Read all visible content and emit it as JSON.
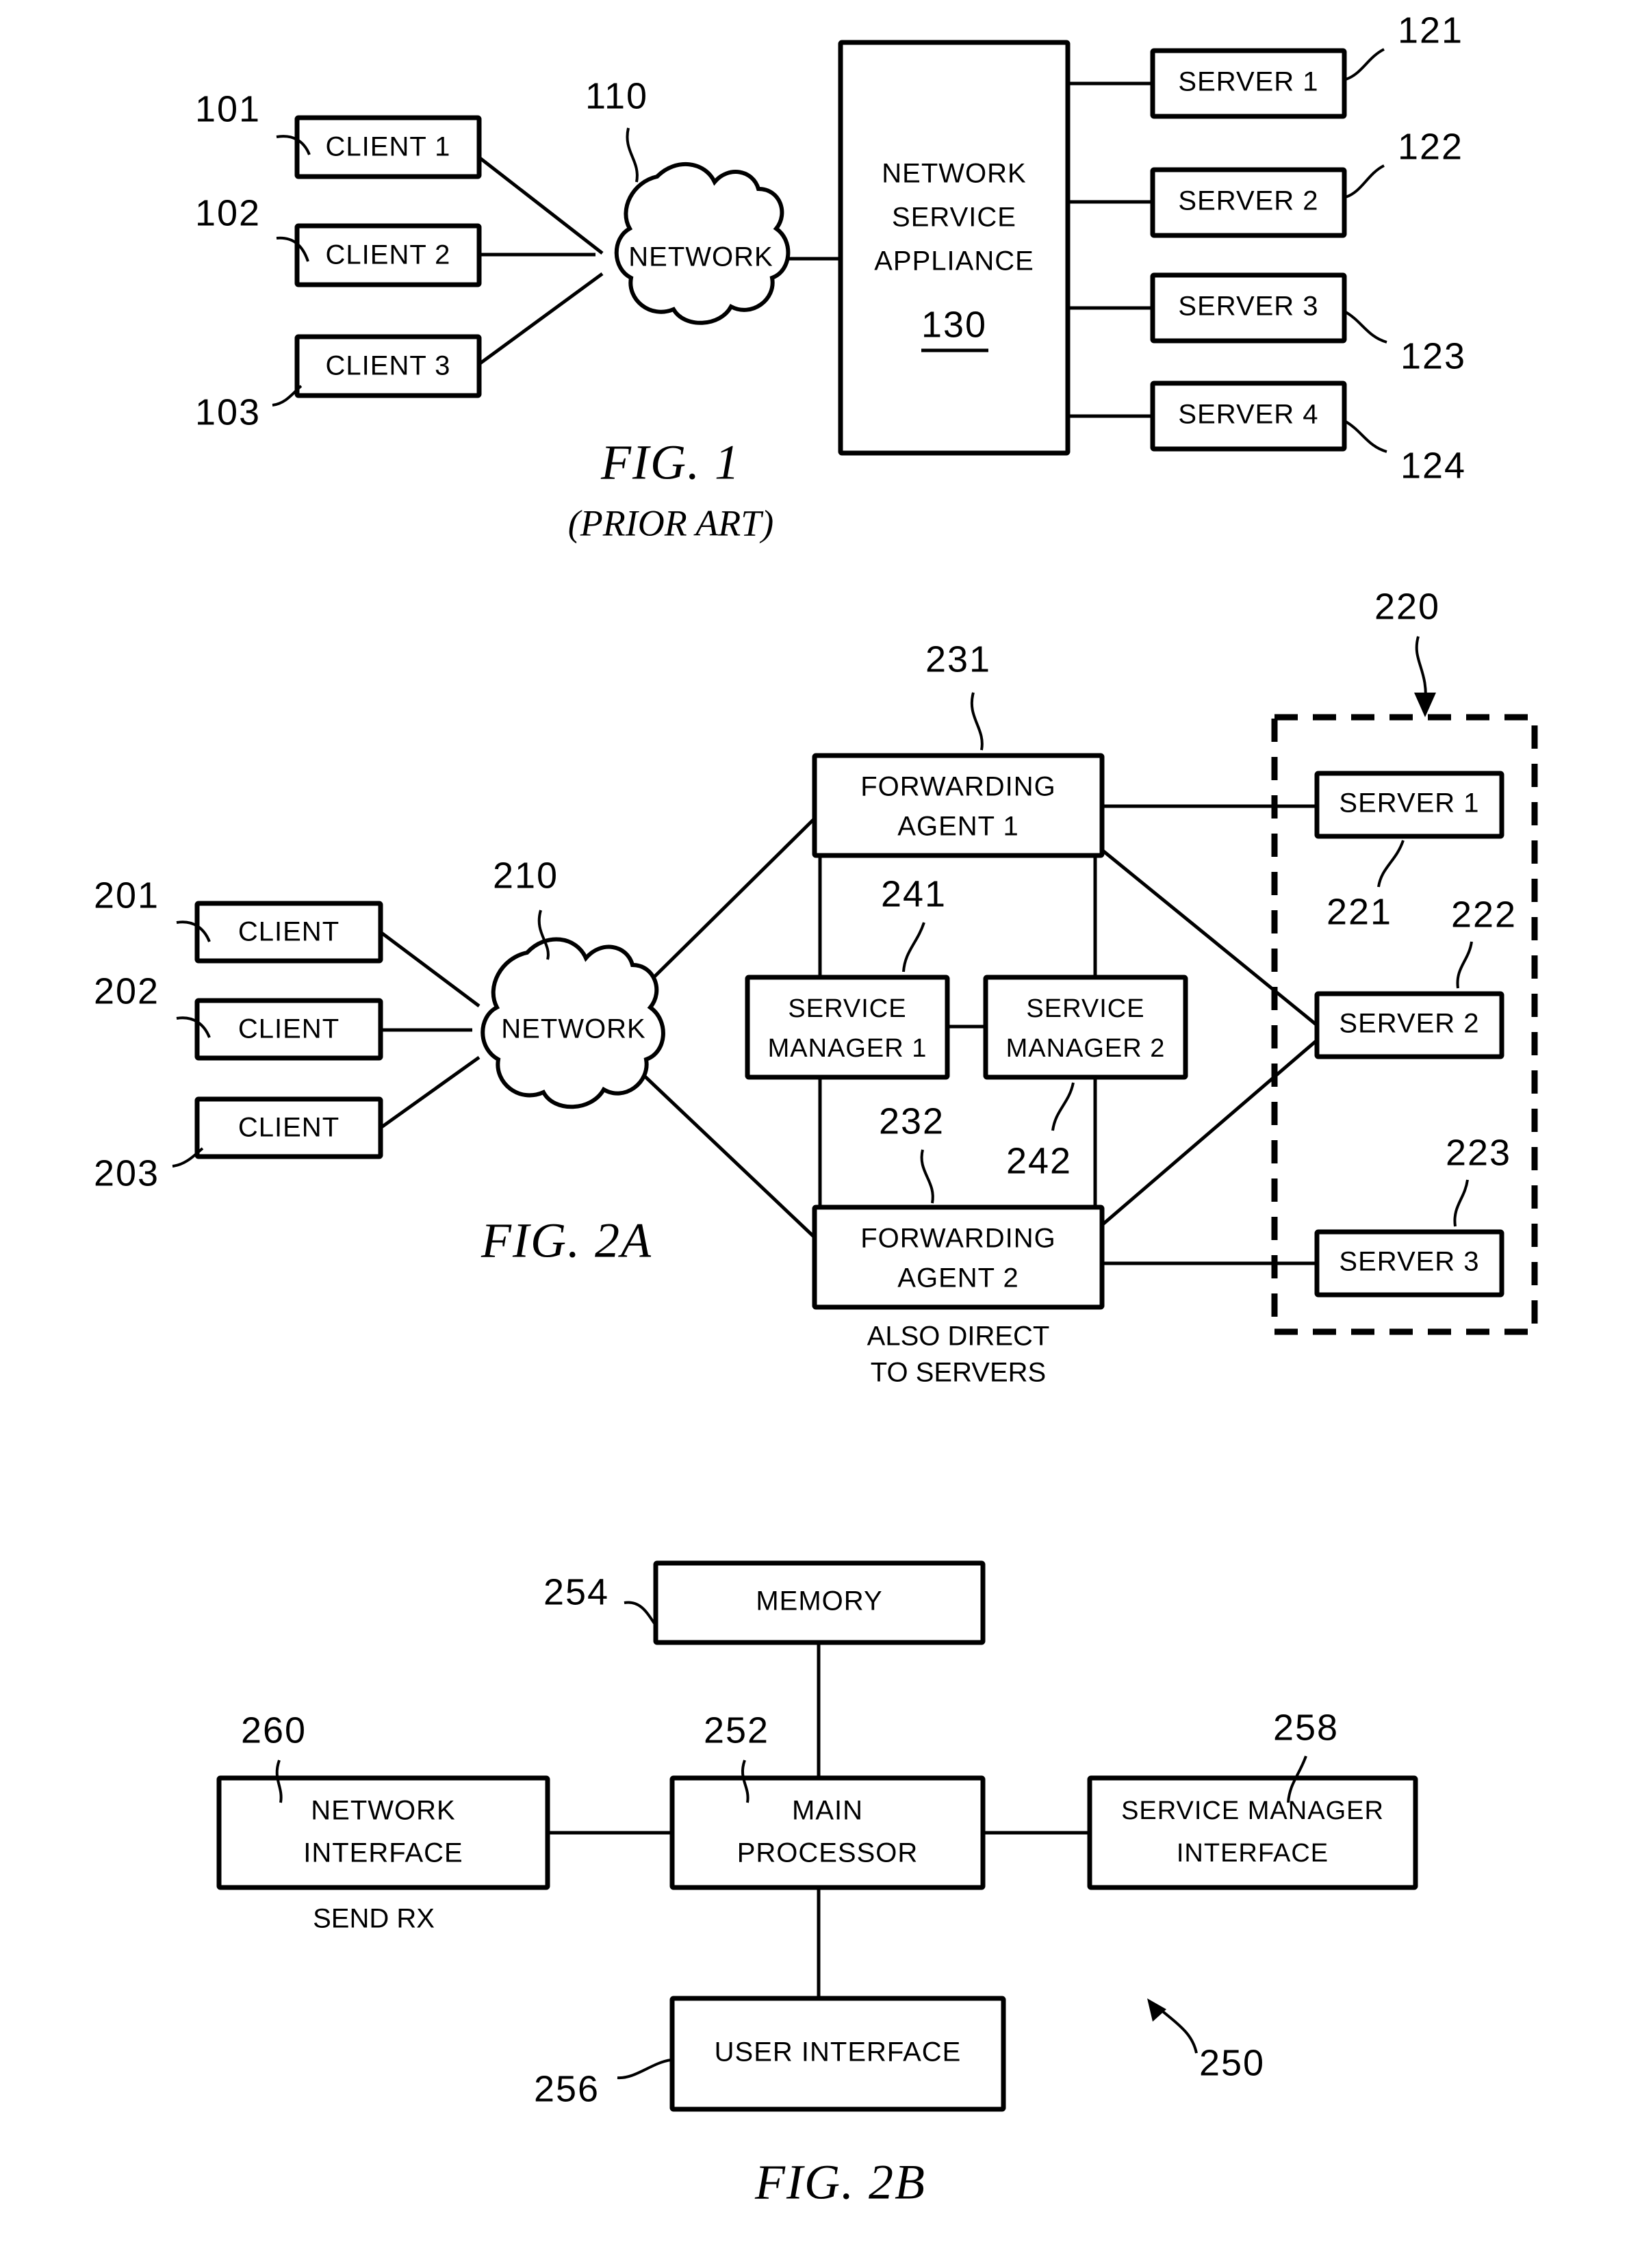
{
  "document": {
    "kind": "patent-drawing-sheet",
    "background_color": "#ffffff",
    "ink_color": "#000000"
  },
  "figures": [
    {
      "id": "fig1",
      "caption": "FIG. 1",
      "subcaption": "(PRIOR ART)",
      "nodes": {
        "clients": [
          {
            "label": "CLIENT 1",
            "ref": "101"
          },
          {
            "label": "CLIENT 2",
            "ref": "102"
          },
          {
            "label": "CLIENT 3",
            "ref": "103"
          }
        ],
        "cloud": {
          "label": "NETWORK",
          "ref": "110"
        },
        "appliance": {
          "line1": "NETWORK",
          "line2": "SERVICE",
          "line3": "APPLIANCE",
          "ref": "130"
        },
        "servers": [
          {
            "label": "SERVER 1",
            "ref": "121"
          },
          {
            "label": "SERVER 2",
            "ref": "122"
          },
          {
            "label": "SERVER 3",
            "ref": "123"
          },
          {
            "label": "SERVER 4",
            "ref": "124"
          }
        ]
      }
    },
    {
      "id": "fig2a",
      "caption": "FIG. 2A",
      "subcaption": "",
      "nodes": {
        "clients": [
          {
            "label": "CLIENT",
            "ref": "201"
          },
          {
            "label": "CLIENT",
            "ref": "202"
          },
          {
            "label": "CLIENT",
            "ref": "203"
          }
        ],
        "cloud": {
          "label": "NETWORK",
          "ref": "210"
        },
        "forwarding_agents": [
          {
            "line1": "FORWARDING",
            "line2": "AGENT 1",
            "ref": "231"
          },
          {
            "line1": "FORWARDING",
            "line2": "AGENT 2",
            "ref": "232"
          }
        ],
        "service_managers": [
          {
            "line1": "SERVICE",
            "line2": "MANAGER 1",
            "ref": "241"
          },
          {
            "line1": "SERVICE",
            "line2": "MANAGER 2",
            "ref": "242"
          }
        ],
        "server_group": {
          "ref": "220"
        },
        "servers": [
          {
            "label": "SERVER 1",
            "ref": "221"
          },
          {
            "label": "SERVER 2",
            "ref": "222"
          },
          {
            "label": "SERVER 3",
            "ref": "223"
          }
        ],
        "annotation": {
          "line1": "ALSO DIRECT",
          "line2": "TO SERVERS"
        }
      }
    },
    {
      "id": "fig2b",
      "caption": "FIG. 2B",
      "subcaption": "",
      "nodes": {
        "memory": {
          "label": "MEMORY",
          "ref": "254"
        },
        "network_interface": {
          "line1": "NETWORK",
          "line2": "INTERFACE",
          "ref": "260",
          "sublabel": "SEND RX"
        },
        "main_processor": {
          "line1": "MAIN",
          "line2": "PROCESSOR",
          "ref": "252"
        },
        "service_manager_interface": {
          "line1": "SERVICE MANAGER",
          "line2": "INTERFACE",
          "ref": "258"
        },
        "user_interface": {
          "label": "USER INTERFACE",
          "ref": "256"
        },
        "system": {
          "ref": "250"
        }
      }
    }
  ]
}
